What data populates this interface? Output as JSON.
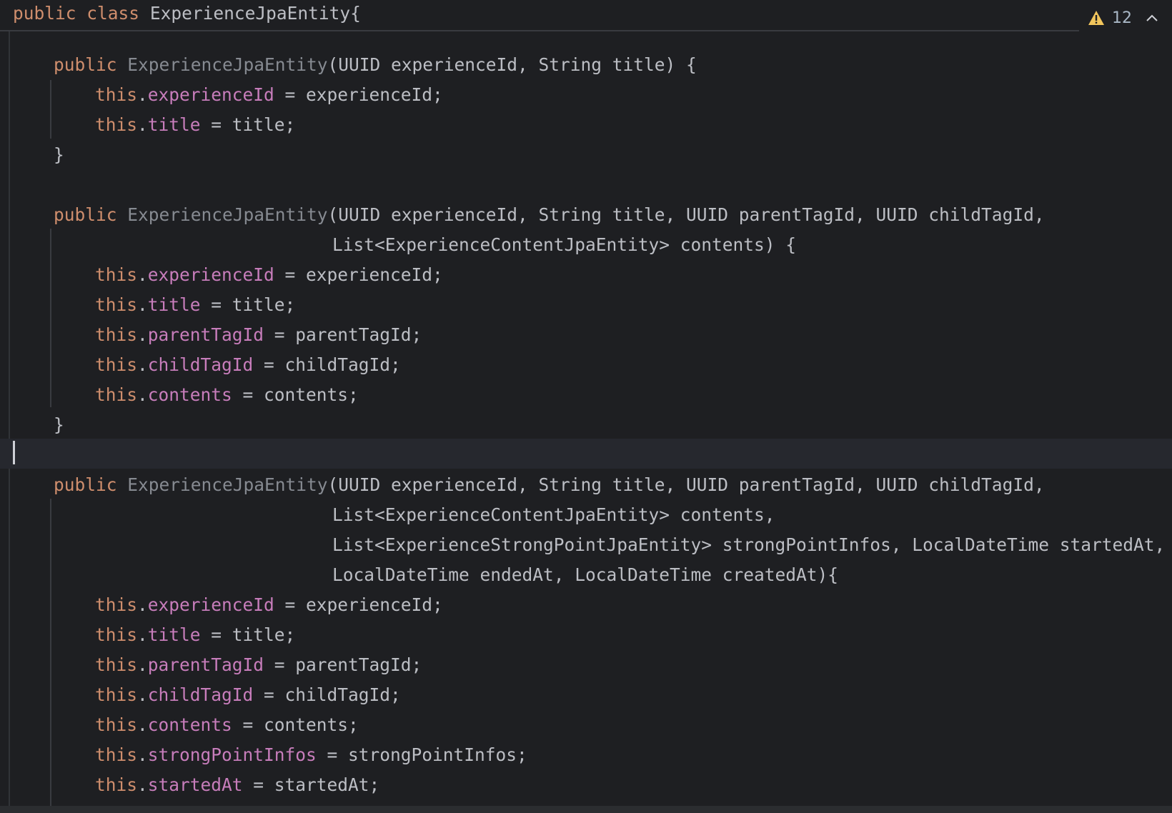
{
  "sticky": {
    "kw_public": "public",
    "kw_class": "class",
    "class_name": "ExperienceJpaEntity{"
  },
  "inspections": {
    "warning_count": "12"
  },
  "code": {
    "kw_public": "public",
    "kw_this": "this",
    "ctor_name": "ExperienceJpaEntity",
    "c1_params": "(UUID experienceId, String title) {",
    "c2_params_1": "(UUID experienceId, String title, UUID parentTagId, UUID childTagId,",
    "c2_params_2": "List<ExperienceContentJpaEntity> contents) {",
    "c3_params_1": "(UUID experienceId, String title, UUID parentTagId, UUID childTagId,",
    "c3_params_2": "List<ExperienceContentJpaEntity> contents,",
    "c3_params_3": "List<ExperienceStrongPointJpaEntity> strongPointInfos, LocalDateTime startedAt,",
    "c3_params_4": "LocalDateTime endedAt, LocalDateTime createdAt){",
    "close_brace": "}",
    "dot": ".",
    "f_experienceId": "experienceId",
    "a_experienceId": " = experienceId;",
    "f_title": "title",
    "a_title": " = title;",
    "f_parentTagId": "parentTagId",
    "a_parentTagId": " = parentTagId;",
    "f_childTagId": "childTagId",
    "a_childTagId": " = childTagId;",
    "f_contents": "contents",
    "a_contents": " = contents;",
    "f_strongPointInfos": "strongPointInfos",
    "a_strongPointInfos": " = strongPointInfos;",
    "f_startedAt": "startedAt",
    "a_startedAt": " = startedAt;"
  }
}
